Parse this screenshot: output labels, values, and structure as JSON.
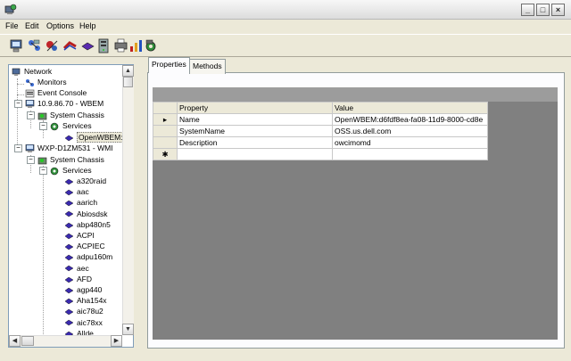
{
  "menu": {
    "file": "File",
    "edit": "Edit",
    "options": "Options",
    "help": "Help"
  },
  "window_buttons": {
    "minimize": "_",
    "maximize": "□",
    "close": "×"
  },
  "tree": {
    "items": [
      {
        "label": "Network"
      },
      {
        "label": "Monitors"
      },
      {
        "label": "Event Console"
      },
      {
        "label": "10.9.86.70 - WBEM"
      },
      {
        "label": "System Chassis"
      },
      {
        "label": "Services"
      },
      {
        "label": "OpenWBEM:"
      },
      {
        "label": "WXP-D1ZM531 - WMI"
      },
      {
        "label": "System Chassis"
      },
      {
        "label": "Services"
      },
      {
        "label": "a320raid"
      },
      {
        "label": "aac"
      },
      {
        "label": "aarich"
      },
      {
        "label": "Abiosdsk"
      },
      {
        "label": "abp480n5"
      },
      {
        "label": "ACPI"
      },
      {
        "label": "ACPIEC"
      },
      {
        "label": "adpu160m"
      },
      {
        "label": "aec"
      },
      {
        "label": "AFD"
      },
      {
        "label": "agp440"
      },
      {
        "label": "Aha154x"
      },
      {
        "label": "aic78u2"
      },
      {
        "label": "aic78xx"
      },
      {
        "label": "Allde"
      }
    ]
  },
  "tabs": {
    "properties": "Properties",
    "methods": "Methods"
  },
  "grid": {
    "headers": {
      "property": "Property",
      "value": "Value"
    },
    "rows": [
      {
        "marker": "▸",
        "property": "Name",
        "value": "OpenWBEM:d6fdf8ea-fa08-11d9-8000-cd8e"
      },
      {
        "marker": "",
        "property": "SystemName",
        "value": "OSS.us.dell.com"
      },
      {
        "marker": "",
        "property": "Description",
        "value": "owcimomd"
      },
      {
        "marker": "✱",
        "property": "",
        "value": ""
      }
    ]
  },
  "colors": {
    "grid_background": "#808080",
    "chrome": "#ece9d8",
    "border": "#7f9db9"
  }
}
